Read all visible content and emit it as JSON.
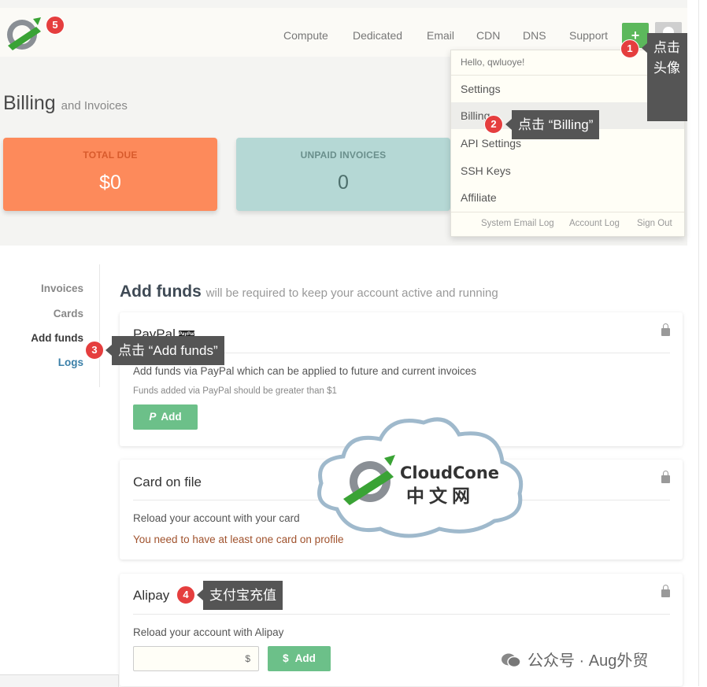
{
  "nav": {
    "links": [
      "Compute",
      "Dedicated",
      "Email",
      "CDN",
      "DNS",
      "Support"
    ],
    "plus_label": "+"
  },
  "header": {
    "title": "Billing",
    "subtitle": "and Invoices"
  },
  "summary": {
    "total_due_label": "TOTAL DUE",
    "total_due_value": "$0",
    "unpaid_label": "UNPAID INVOICES",
    "unpaid_value": "0"
  },
  "dropdown": {
    "hello": "Hello, qwluoye!",
    "items": [
      "Settings",
      "Billing",
      "API Settings",
      "SSH Keys",
      "Affiliate"
    ],
    "footer": [
      "System Email Log",
      "Account Log",
      "Sign Out"
    ]
  },
  "sidebar": {
    "items": [
      "Invoices",
      "Cards",
      "Add funds",
      "Logs"
    ]
  },
  "add_funds": {
    "title": "Add funds",
    "subtitle": "will be required to keep your account active and running"
  },
  "paypal": {
    "title": "PayPal",
    "badge": "PayPal",
    "text": "Add funds via PayPal which can be applied to future and current invoices",
    "note": "Funds added via PayPal should be greater than $1",
    "button": "Add",
    "button_icon": "P"
  },
  "card_on_file": {
    "title": "Card on file",
    "text": "Reload your account with your card",
    "warning": "You need to have at least one card on profile"
  },
  "alipay": {
    "title": "Alipay",
    "text": "Reload your account with Alipay",
    "currency": "$",
    "button": "Add",
    "button_icon": "$"
  },
  "annotations": {
    "badge1": "1",
    "tip1": "点击\n头像",
    "badge2": "2",
    "tip2": "点击 “Billing”",
    "badge3": "3",
    "tip3": "点击 “Add funds”",
    "badge4": "4",
    "tip4": "支付宝充值",
    "badge5": "5"
  },
  "watermark": {
    "cloud_line1": "CloudCone",
    "cloud_line2": "中文网",
    "wechat": "公众号 · Aug外贸"
  },
  "colors": {
    "accent_green": "#5cb85c",
    "total_due": "#fd8a5b",
    "unpaid": "#b5d8d5",
    "badge_red": "#e53e3e"
  }
}
